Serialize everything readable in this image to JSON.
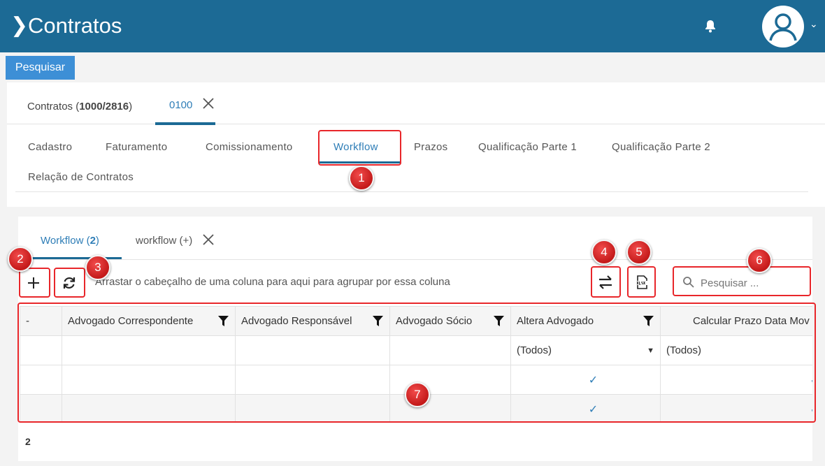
{
  "header": {
    "title": "Contratos"
  },
  "toolbar": {
    "search_button": "Pesquisar"
  },
  "doc_tabs": [
    {
      "label_prefix": "Contratos (",
      "count": "1000/2816",
      "label_suffix": ")"
    },
    {
      "label": "0100"
    }
  ],
  "sub_tabs": [
    "Cadastro",
    "Faturamento",
    "Comissionamento",
    "Workflow",
    "Prazos",
    "Qualificação Parte 1",
    "Qualificação Parte 2",
    "Relação de Contratos"
  ],
  "active_sub_tab": "Workflow",
  "workflow": {
    "tabs": [
      {
        "label_prefix": "Workflow (",
        "count": "2",
        "label_suffix": ")"
      },
      {
        "label": "workflow (+)"
      }
    ],
    "group_hint": "Arrastar o cabeçalho de uma coluna para aqui para agrupar por essa coluna",
    "search_placeholder": "Pesquisar ...",
    "grid": {
      "columns": [
        "-",
        "Advogado Correspondente",
        "Advogado Responsável",
        "Advogado Sócio",
        "Altera Advogado",
        "Calcular Prazo Data Mov"
      ],
      "filters": {
        "altera_advogado": "(Todos)",
        "calcular_prazo": "(Todos)"
      },
      "rows": [
        {
          "altera_advogado": true,
          "calcular_prazo": true
        },
        {
          "altera_advogado": true,
          "calcular_prazo": true
        }
      ]
    },
    "record_count": "2"
  },
  "annotations": [
    "1",
    "2",
    "3",
    "4",
    "5",
    "6",
    "7"
  ],
  "colors": {
    "header_bg": "#1c6a95",
    "accent": "#2f7eb7",
    "button": "#3d8fd6",
    "annotation": "#e8262a"
  },
  "icons": [
    "chevron-right-icon",
    "bell-icon",
    "user-avatar-icon",
    "close-icon",
    "plus-icon",
    "refresh-icon",
    "swap-icon",
    "xlsx-export-icon",
    "search-icon",
    "filter-icon",
    "checkmark-icon"
  ]
}
